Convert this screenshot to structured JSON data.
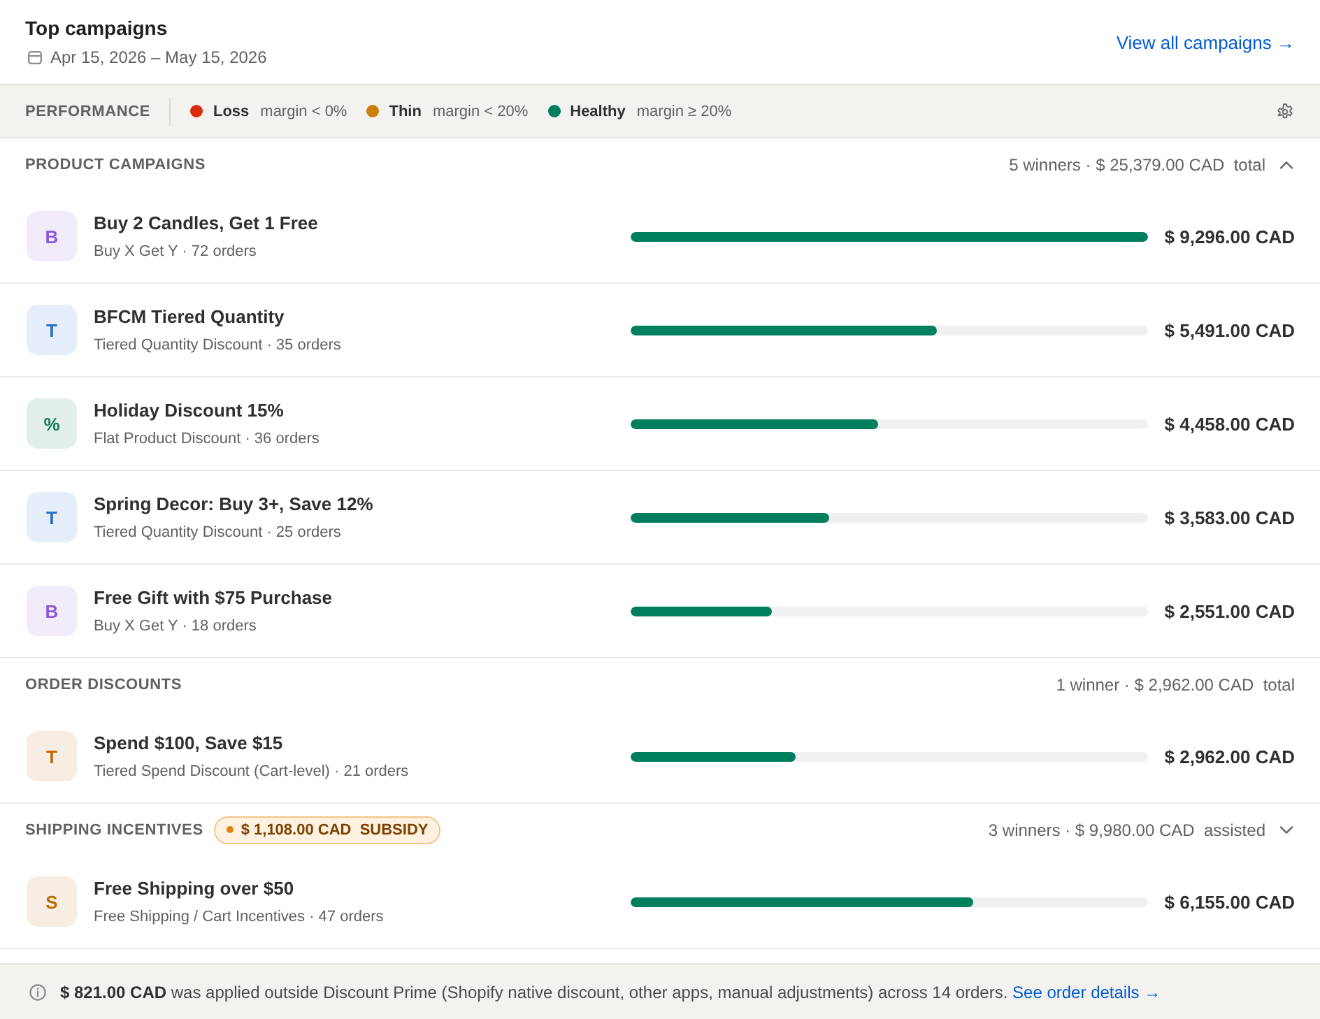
{
  "header": {
    "title": "Top campaigns",
    "date_range": "Apr 15, 2026 – May 15, 2026",
    "link": "View all campaigns →"
  },
  "performance": {
    "label": "PERFORMANCE",
    "legend": [
      {
        "label": "Loss",
        "note": "margin < 0%",
        "color": "#d72c0d"
      },
      {
        "label": "Thin",
        "note": "margin < 20%",
        "color": "#c8800a"
      },
      {
        "label": "Healthy",
        "note": "margin ≥ 20%",
        "color": "#007f5f"
      }
    ]
  },
  "sections": [
    {
      "title": "PRODUCT CAMPAIGNS",
      "summary": "5 winners · $ 25,379.00 CAD  total",
      "expanded": true,
      "campaigns": [
        {
          "badge": "B",
          "color": "#8c5cd9",
          "name": "Buy 2 Candles, Get 1 Free",
          "detail": "Buy X Get Y · 72 orders",
          "level": 1.0,
          "amount": "$ 9,296.00 CAD"
        },
        {
          "badge": "T",
          "color": "#2c6ecb",
          "name": "BFCM Tiered Quantity",
          "detail": "Tiered Quantity Discount · 35 orders",
          "level": 0.591,
          "amount": "$ 5,491.00 CAD"
        },
        {
          "badge": "%",
          "color": "#147a58",
          "name": "Holiday Discount 15%",
          "detail": "Flat Product Discount · 36 orders",
          "level": 0.48,
          "amount": "$ 4,458.00 CAD"
        },
        {
          "badge": "T",
          "color": "#2c6ecb",
          "name": "Spring Decor: Buy 3+, Save 12%",
          "detail": "Tiered Quantity Discount · 25 orders",
          "level": 0.385,
          "amount": "$ 3,583.00 CAD"
        },
        {
          "badge": "B",
          "color": "#8c5cd9",
          "name": "Free Gift with $75 Purchase",
          "detail": "Buy X Get Y · 18 orders",
          "level": 0.274,
          "amount": "$ 2,551.00 CAD"
        }
      ]
    },
    {
      "title": "ORDER DISCOUNTS",
      "summary": "1 winner · $ 2,962.00 CAD  total",
      "campaigns": [
        {
          "badge": "T",
          "color": "#bf6a0c",
          "name": "Spend $100, Save $15",
          "detail": "Tiered Spend Discount (Cart-level) · 21 orders",
          "level": 0.319,
          "amount": "$ 2,962.00 CAD"
        }
      ]
    },
    {
      "title": "SHIPPING INCENTIVES",
      "badge": "$ 1,108.00 CAD  SUBSIDY",
      "summary": "3 winners · $ 9,980.00 CAD  assisted",
      "expanded": false,
      "campaigns": [
        {
          "badge": "S",
          "color": "#bf6a0c",
          "name": "Free Shipping over $50",
          "detail": "Free Shipping / Cart Incentives · 47 orders",
          "level": 0.662,
          "amount": "$ 6,155.00 CAD"
        }
      ]
    }
  ],
  "footer": {
    "note": "**$ 821.00 CAD** was applied outside Discount Prime (Shopify native discount, other apps, manual adjustments) across 14 orders.",
    "link": "See order details →"
  }
}
